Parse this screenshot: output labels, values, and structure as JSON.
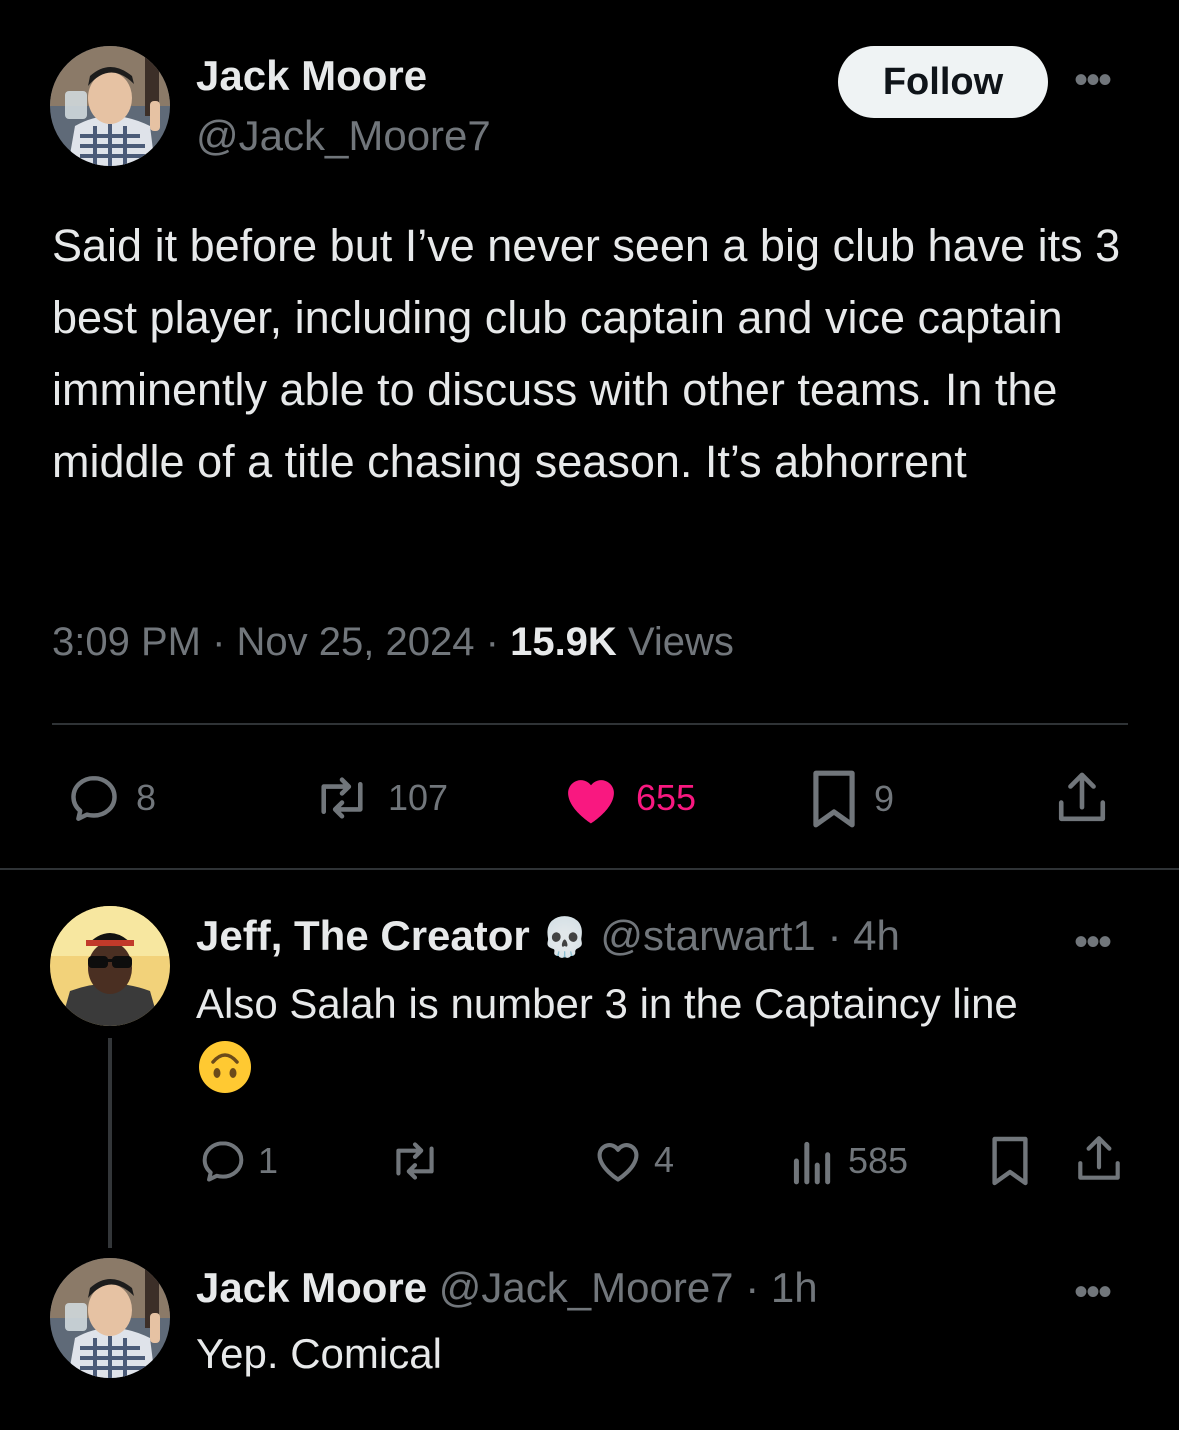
{
  "main_tweet": {
    "author_name": "Jack Moore",
    "author_handle": "@Jack_Moore7",
    "follow_label": "Follow",
    "text": "Said it before but I’ve never seen a big club have its 3 best player, including club captain and vice captain imminently able to discuss with other teams. In the middle of a title chasing season. It’s abhorrent",
    "time": "3:09 PM",
    "sep1": "·",
    "date": "Nov 25, 2024",
    "sep2": "·",
    "views_count": "15.9K",
    "views_label": "Views",
    "replies": "8",
    "reposts": "107",
    "likes": "655",
    "bookmarks": "9"
  },
  "reply_1": {
    "author_name": "Jeff, The Creator",
    "author_emoji": "💀",
    "author_handle": "@starwart1",
    "time": "· 4h",
    "text": "Also Salah is number 3 in the Captaincy line",
    "replies": "1",
    "likes": "4",
    "views": "585"
  },
  "reply_2": {
    "author_name": "Jack Moore",
    "author_handle": "@Jack_Moore7",
    "time": "· 1h",
    "text": "Yep. Comical"
  },
  "colors": {
    "background": "#000000",
    "text": "#e7e9ea",
    "muted": "#71767b",
    "like_active": "#f91880",
    "follow_bg": "#eff3f4"
  }
}
